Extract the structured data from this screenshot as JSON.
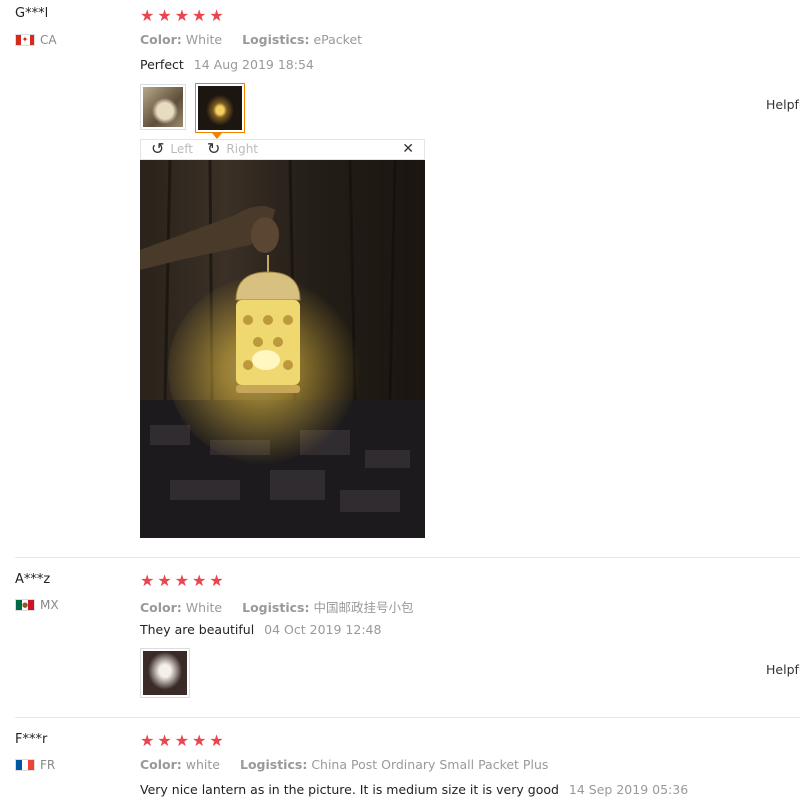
{
  "reviews": [
    {
      "user": "G***l",
      "country": "CA",
      "stars": "★★★★★",
      "color_label": "Color:",
      "color_value": "White",
      "logistics_label": "Logistics:",
      "logistics_value": "ePacket",
      "feedback": "Perfect",
      "date": "14 Aug 2019 18:54",
      "helpful": "Helpfu"
    },
    {
      "user": "A***z",
      "country": "MX",
      "stars": "★★★★★",
      "color_label": "Color:",
      "color_value": "White",
      "logistics_label": "Logistics:",
      "logistics_value": "中国邮政挂号小包",
      "feedback": "They are beautiful",
      "date": "04 Oct 2019 12:48",
      "helpful": "Helpfu"
    },
    {
      "user": "F***r",
      "country": "FR",
      "stars": "★★★★★",
      "color_label": "Color:",
      "color_value": "white",
      "logistics_label": "Logistics:",
      "logistics_value": "China Post Ordinary Small Packet Plus",
      "feedback": "Very nice lantern as in the picture. It is medium size it is very good",
      "date": "14 Sep 2019 05:36"
    }
  ],
  "viewer": {
    "rotate_left": "Left",
    "rotate_right": "Right",
    "rotate_left_icon": "↺",
    "rotate_right_icon": "↻",
    "close_icon": "✕"
  },
  "colors": {
    "star": "#e8474f",
    "active_thumb": "#f08200"
  }
}
